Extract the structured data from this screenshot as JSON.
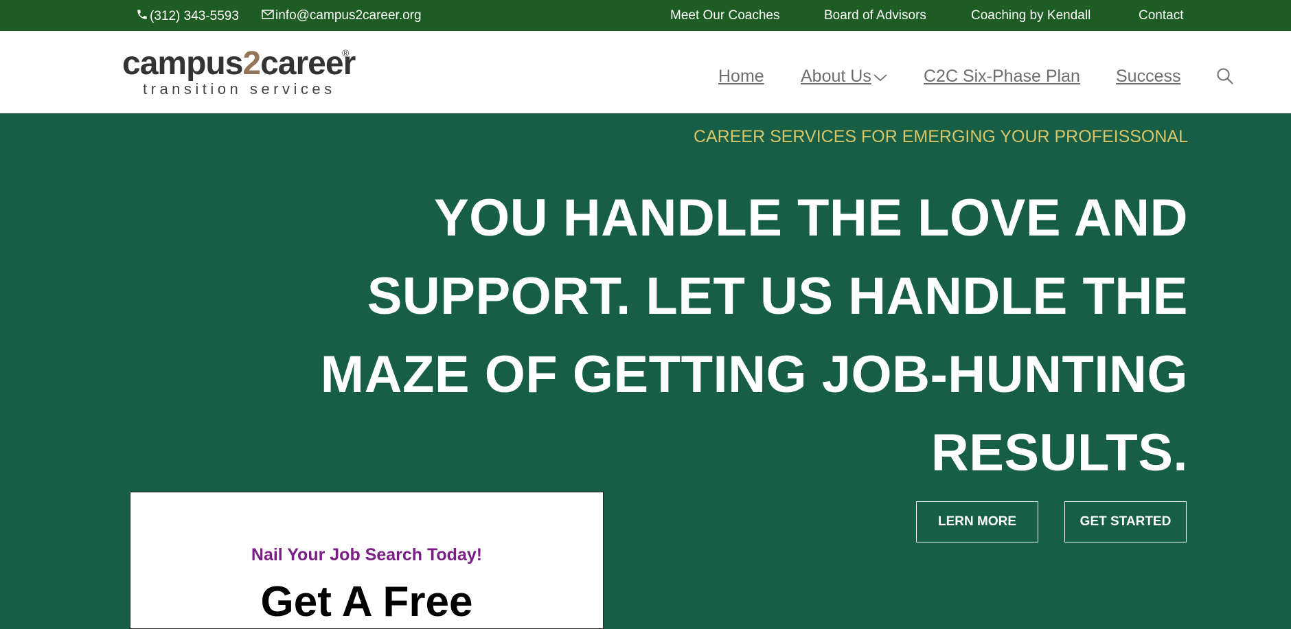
{
  "topbar": {
    "phone": "(312) 343-5593",
    "email": "info@campus2career.org",
    "links": [
      "Meet Our Coaches",
      "Board of Advisors",
      "Coaching by Kendall",
      "Contact"
    ],
    "background": "#1d5c22"
  },
  "header": {
    "logo": {
      "word_start": "campus",
      "word_two": "2",
      "word_end": "career",
      "registered": "®",
      "subtitle": "transition services"
    },
    "nav": {
      "home": "Home",
      "about": "About Us",
      "plan": "C2C Six-Phase Plan",
      "success": "Success"
    },
    "icons": [
      "phone-icon",
      "mail-icon",
      "chevron-down-icon",
      "search-icon"
    ]
  },
  "hero": {
    "tagline": "CAREER SERVICES FOR EMERGING YOUR PROFEISSONAL",
    "headline_lines": [
      "YOU HANDLE THE LOVE AND",
      "SUPPORT. LET US HANDLE THE",
      "MAZE OF GETTING JOB-HUNTING",
      "RESULTS."
    ],
    "buttons": {
      "learn_more": "LERN MORE",
      "get_started": "GET STARTED"
    },
    "card": {
      "kicker": "Nail Your Job Search Today!",
      "title": "Get A Free"
    },
    "colors": {
      "background": "#165e45",
      "tagline": "#d7c56a",
      "kicker": "#7a1e86"
    }
  }
}
